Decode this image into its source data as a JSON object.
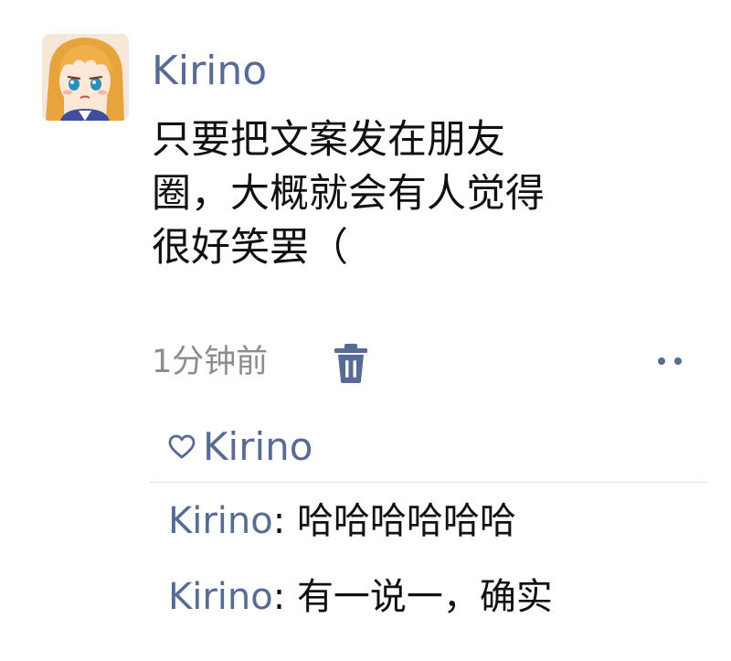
{
  "post": {
    "author": "Kirino",
    "avatar_icon": "anime-girl-avatar",
    "text_lines": [
      "只要把文案发在朋友",
      "圈，大概就会有人觉得",
      "很好笑罢（"
    ],
    "time": "1分钟前",
    "delete_icon": "trash-icon",
    "more_icon": "more-dots-icon"
  },
  "likes": {
    "icon": "heart-outline-icon",
    "names": [
      "Kirino"
    ]
  },
  "comments": [
    {
      "author": "Kirino",
      "separator": ":",
      "text": "哈哈哈哈哈哈"
    },
    {
      "author": "Kirino",
      "separator": ":",
      "text": "有一说一，确实"
    }
  ],
  "colors": {
    "link": "#576b95",
    "text": "#111111",
    "muted": "#8c8c8c",
    "divider": "#e4e4e4"
  }
}
